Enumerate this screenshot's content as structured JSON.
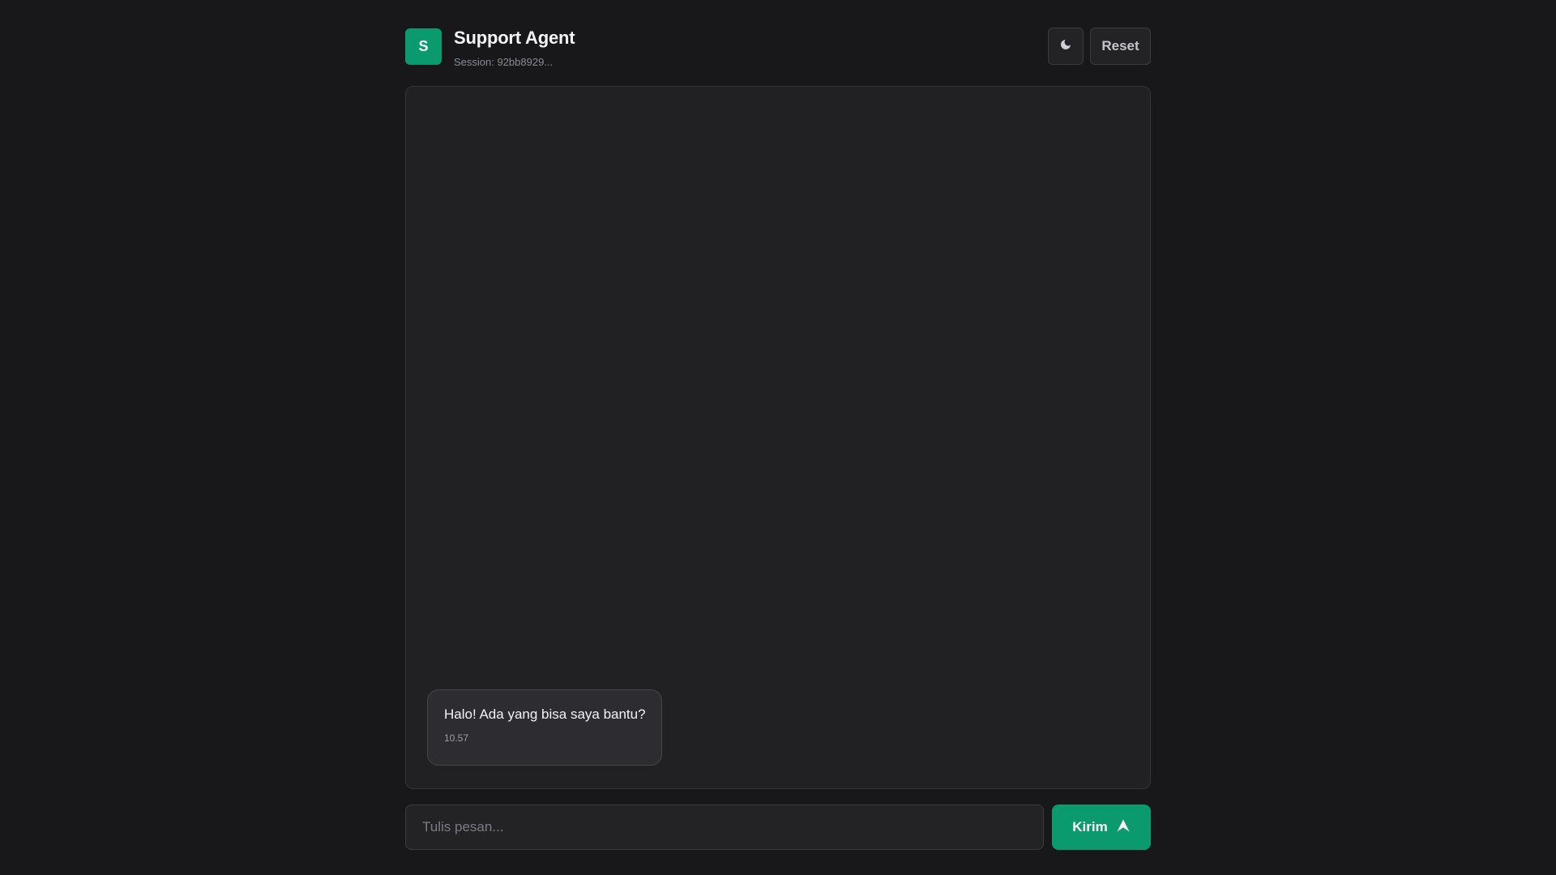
{
  "header": {
    "avatar_initial": "S",
    "title": "Support Agent",
    "session": "Session: 92bb8929...",
    "theme_icon": "moon-icon",
    "reset_label": "Reset"
  },
  "messages": [
    {
      "sender": "agent",
      "text": "Halo! Ada yang bisa saya bantu?",
      "time": "10.57"
    }
  ],
  "composer": {
    "placeholder": "Tulis pesan...",
    "value": "",
    "send_label": "Kirim",
    "send_icon": "send-icon"
  },
  "colors": {
    "accent": "#0a9a6e",
    "background": "#18181b",
    "panel": "#212124"
  }
}
